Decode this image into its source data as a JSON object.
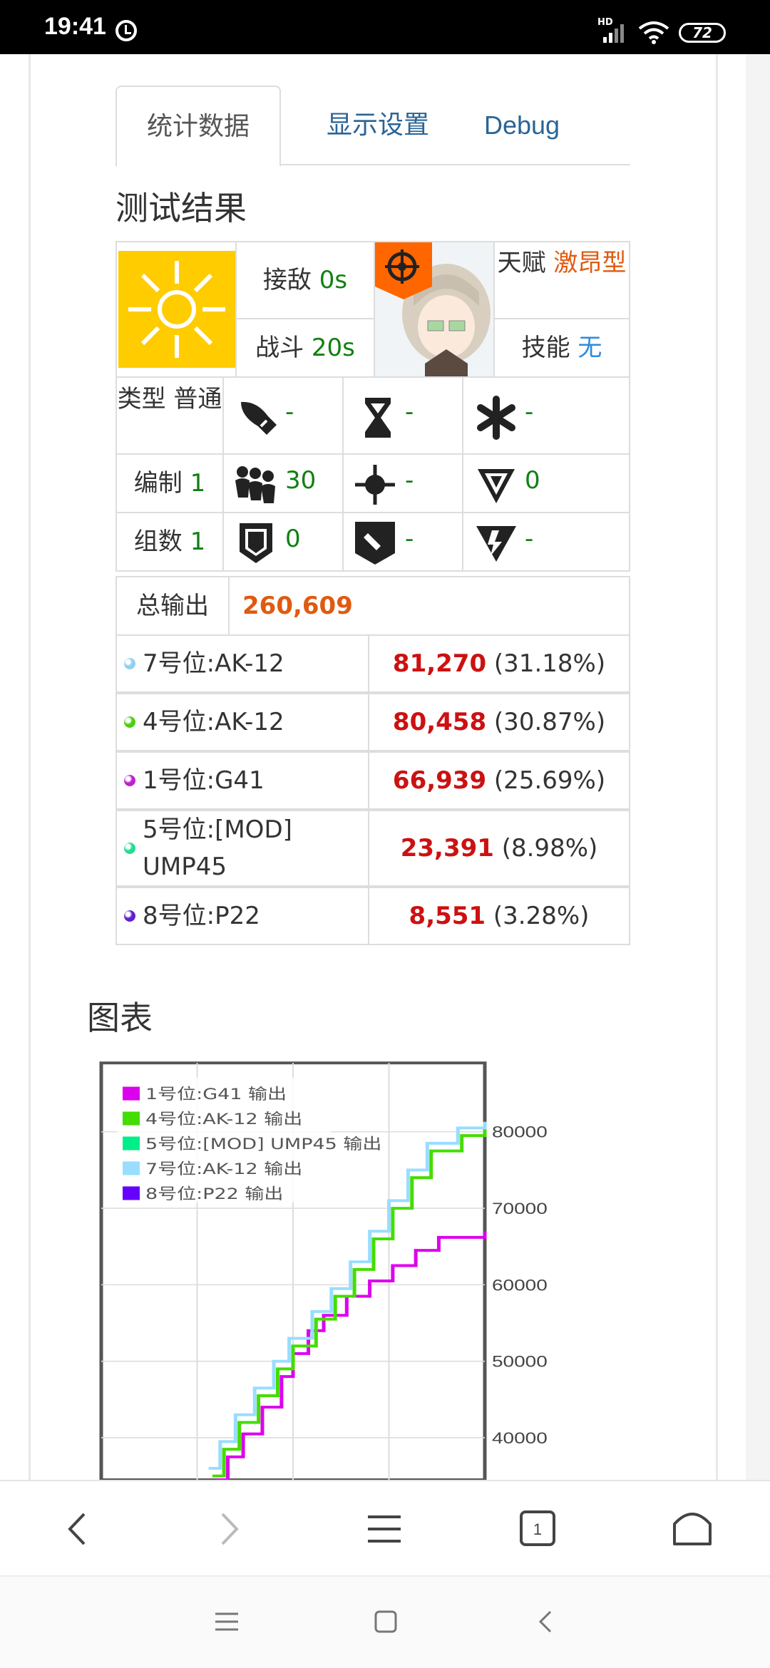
{
  "status_bar": {
    "time": "19:41",
    "network": "HD",
    "battery": "72"
  },
  "tabs": [
    {
      "label": "统计数据",
      "active": true
    },
    {
      "label": "显示设置",
      "active": false
    },
    {
      "label": "Debug",
      "active": false
    }
  ],
  "results": {
    "heading": "测试结果",
    "engage_label": "接敌",
    "engage_value": "0s",
    "battle_label": "战斗",
    "battle_value": "20s",
    "talent_label": "天赋",
    "talent_value": "激昂型",
    "skill_label": "技能",
    "skill_value": "无",
    "type_label": "类型",
    "type_value": "普通",
    "formation_label": "编制",
    "formation_value": "1",
    "groups_label": "组数",
    "groups_value": "1",
    "stats": {
      "damage": "-",
      "rate": "-",
      "crit": "-",
      "hp": "30",
      "accuracy": "-",
      "armor_pen": "0",
      "armor": "0",
      "shield": "-",
      "crit_dmg": "-"
    },
    "total_label": "总输出",
    "total_value": "260,609",
    "rows": [
      {
        "name": "7号位:AK-12",
        "value": "81,270",
        "pct": "(31.18%)",
        "dot": "#8fd0f0"
      },
      {
        "name": "4号位:AK-12",
        "value": "80,458",
        "pct": "(30.87%)",
        "dot": "#4cd010"
      },
      {
        "name": "1号位:G41",
        "value": "66,939",
        "pct": "(25.69%)",
        "dot": "#c020d0"
      },
      {
        "name": "5号位:[MOD] UMP45",
        "value": "23,391",
        "pct": "(8.98%)",
        "dot": "#20e090"
      },
      {
        "name": "8号位:P22",
        "value": "8,551",
        "pct": "(3.28%)",
        "dot": "#6020d0"
      }
    ]
  },
  "chart_heading": "图表",
  "chart_data": {
    "type": "line",
    "step": true,
    "y_ticks": [
      40000,
      50000,
      60000,
      70000,
      80000
    ],
    "ylim": [
      34500,
      89000
    ],
    "y_axis_side": "right",
    "grid": true,
    "legend_position": "top-left",
    "series": [
      {
        "name": "1号位:G41 输出",
        "color": "#dd00ee",
        "points": [
          [
            0.3,
            34500
          ],
          [
            0.33,
            37500
          ],
          [
            0.37,
            40500
          ],
          [
            0.42,
            44000
          ],
          [
            0.47,
            48000
          ],
          [
            0.5,
            51000
          ],
          [
            0.54,
            54000
          ],
          [
            0.58,
            56000
          ],
          [
            0.64,
            58500
          ],
          [
            0.7,
            60500
          ],
          [
            0.76,
            62500
          ],
          [
            0.82,
            64500
          ],
          [
            0.88,
            66200
          ],
          [
            1.0,
            67000
          ]
        ]
      },
      {
        "name": "4号位:AK-12 输出",
        "color": "#44dd00",
        "points": [
          [
            0.29,
            35000
          ],
          [
            0.32,
            38500
          ],
          [
            0.36,
            42000
          ],
          [
            0.41,
            45500
          ],
          [
            0.46,
            49000
          ],
          [
            0.5,
            52000
          ],
          [
            0.56,
            55500
          ],
          [
            0.61,
            58500
          ],
          [
            0.66,
            62000
          ],
          [
            0.71,
            66000
          ],
          [
            0.76,
            70000
          ],
          [
            0.81,
            74000
          ],
          [
            0.86,
            77500
          ],
          [
            0.94,
            79500
          ],
          [
            1.0,
            80500
          ]
        ]
      },
      {
        "name": "5号位:[MOD] UMP45 输出",
        "color": "#00ee88",
        "points": []
      },
      {
        "name": "7号位:AK-12 输出",
        "color": "#99ddff",
        "points": [
          [
            0.28,
            36000
          ],
          [
            0.31,
            39500
          ],
          [
            0.35,
            43000
          ],
          [
            0.4,
            46500
          ],
          [
            0.45,
            50000
          ],
          [
            0.49,
            53000
          ],
          [
            0.55,
            56500
          ],
          [
            0.6,
            59500
          ],
          [
            0.65,
            63000
          ],
          [
            0.7,
            67000
          ],
          [
            0.75,
            71000
          ],
          [
            0.8,
            75000
          ],
          [
            0.85,
            78500
          ],
          [
            0.93,
            80500
          ],
          [
            1.0,
            81300
          ]
        ]
      },
      {
        "name": "8号位:P22 输出",
        "color": "#6600ff",
        "points": []
      }
    ]
  }
}
